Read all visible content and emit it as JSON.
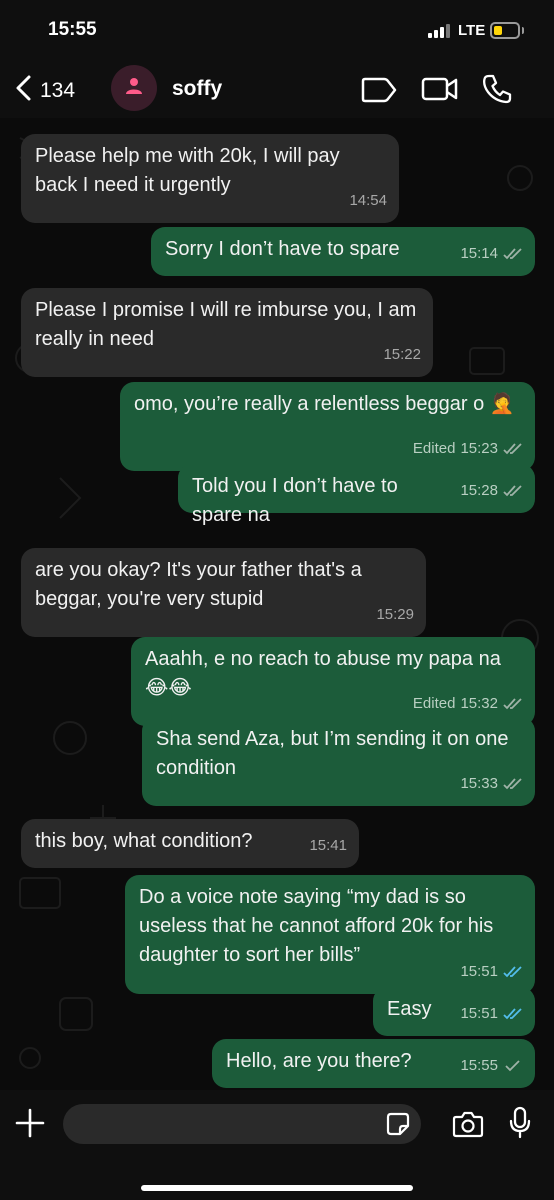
{
  "status_bar": {
    "time": "15:55",
    "network": "LTE",
    "battery_color": "#ffd60a"
  },
  "header": {
    "back_count": "134",
    "contact_name": "soffy",
    "icons": [
      "chevron-left-icon",
      "person-icon",
      "label-icon",
      "video-call-icon",
      "phone-icon"
    ]
  },
  "colors": {
    "incoming_bubble": "#2a2a2a",
    "outgoing_bubble": "#1c5c3a",
    "read_tick": "#53bdeb",
    "delivered_tick": "#9fb3a8"
  },
  "messages": [
    {
      "direction": "in",
      "text": "Please help me with 20k, I will pay back I need it urgently",
      "time": "14:54"
    },
    {
      "direction": "out",
      "text": "Sorry I don’t have to spare",
      "time": "15:14",
      "status": "delivered"
    },
    {
      "direction": "in",
      "text": "Please I promise I will re imburse you, I am really in need",
      "time": "15:22"
    },
    {
      "direction": "out",
      "text": "omo, you’re really a relentless beggar o 🤦",
      "time": "15:23",
      "edited": "Edited",
      "status": "delivered"
    },
    {
      "direction": "out",
      "text": "Told you I don’t have to spare na",
      "time": "15:28",
      "status": "delivered"
    },
    {
      "direction": "in",
      "text": "are you okay? It's your father that's a beggar, you're very stupid",
      "time": "15:29"
    },
    {
      "direction": "out",
      "text": "Aaahh, e no reach to abuse my papa na 😂😂",
      "time": "15:32",
      "edited": "Edited",
      "status": "delivered"
    },
    {
      "direction": "out",
      "text": "Sha send Aza, but I’m sending it on one condition",
      "time": "15:33",
      "status": "delivered"
    },
    {
      "direction": "in",
      "text": "this boy, what condition?",
      "time": "15:41"
    },
    {
      "direction": "out",
      "text": "Do a voice note saying “my dad is so useless that he cannot afford 20k for his daughter to sort her bills”",
      "time": "15:51",
      "status": "read"
    },
    {
      "direction": "out",
      "text": "Easy",
      "time": "15:51",
      "status": "read"
    },
    {
      "direction": "out",
      "text": "Hello, are you there?",
      "time": "15:55",
      "status": "sent"
    }
  ],
  "input": {
    "placeholder": ""
  }
}
